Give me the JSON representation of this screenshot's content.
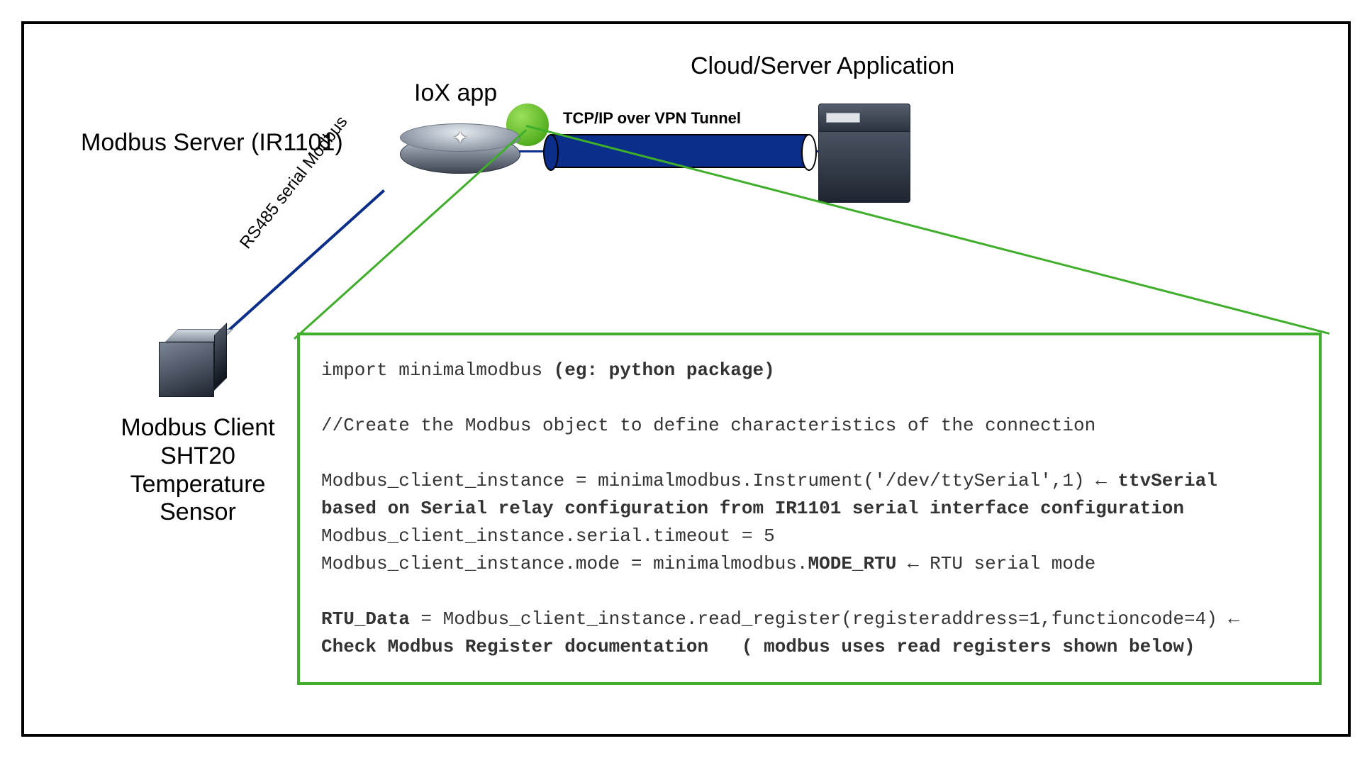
{
  "labels": {
    "cloud_server": "Cloud/Server Application",
    "iox_app": "IoX app",
    "modbus_server": "Modbus Server (IR1101)",
    "tcp_vpn": "TCP/IP over VPN Tunnel",
    "rs485": "RS485 serial Modbus",
    "modbus_client_l1": "Modbus Client",
    "modbus_client_l2": "SHT20",
    "modbus_client_l3": "Temperature Sensor"
  },
  "code": {
    "l1a": "import minimalmodbus ",
    "l1b": "(eg: python package)",
    "l2": "//Create the Modbus object to define characteristics of the connection",
    "l3a": "Modbus_client_instance = minimalmodbus.Instrument('/dev/ttySerial',1) ",
    "l3b": "← ttvSerial",
    "l4": "based on Serial relay configuration from IR1101 serial interface configuration",
    "l5": "Modbus_client_instance.serial.timeout = 5",
    "l6a": "Modbus_client_instance.mode = minimalmodbus.",
    "l6b": "MODE_RTU",
    "l6c": " ← RTU serial mode",
    "l7a": "RTU_Data",
    "l7b": " = Modbus_client_instance.read_register(registeraddress=1,functioncode=4) ",
    "l7c": "←",
    "l8": "Check Modbus Register documentation   ( modbus uses read registers shown below)"
  }
}
